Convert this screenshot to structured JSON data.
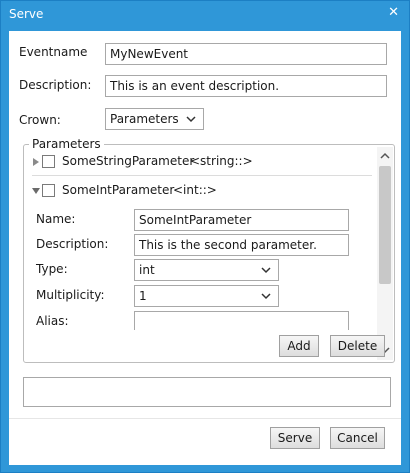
{
  "window": {
    "title": "Serve",
    "close_glyph": "✕"
  },
  "event": {
    "eventname_label": "Eventname",
    "eventname_value": "MyNewEvent",
    "description_label": "Description:",
    "description_value": "This is an event description.",
    "crown_label": "Crown:",
    "crown_value": "Parameters"
  },
  "parameters": {
    "group_title": "Parameters",
    "items": [
      {
        "name": "SomeStringParameter",
        "type_tag": "<string::>",
        "expanded": false,
        "checked": false
      },
      {
        "name": "SomeIntParameter",
        "type_tag": "<int::>",
        "expanded": true,
        "checked": false
      }
    ],
    "detail": {
      "name_label": "Name:",
      "name_value": "SomeIntParameter",
      "description_label": "Description:",
      "description_value": "This is the second parameter.",
      "type_label": "Type:",
      "type_value": "int",
      "multiplicity_label": "Multiplicity:",
      "multiplicity_value": "1",
      "alias_label": "Alias:",
      "alias_value": ""
    },
    "add_label": "Add",
    "delete_label": "Delete"
  },
  "status_text": "",
  "footer": {
    "serve_label": "Serve",
    "cancel_label": "Cancel"
  },
  "icons": {
    "close": "close-icon",
    "chevron": "chevron-down-icon",
    "expander_collapsed": "triangle-right-icon",
    "expander_expanded": "triangle-down-icon",
    "scroll_up": "scroll-up-icon",
    "scroll_down": "scroll-down-icon"
  },
  "colors": {
    "titlebar": "#2f97d8",
    "border": "#a8a8a8",
    "window_bg": "#ffffff"
  }
}
